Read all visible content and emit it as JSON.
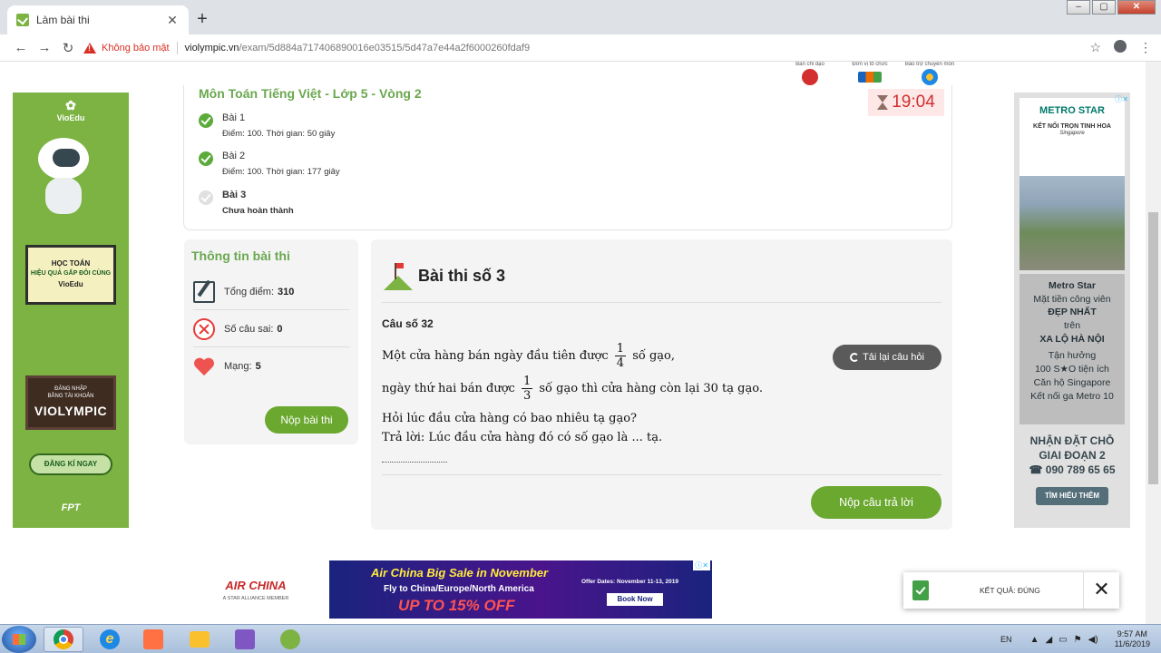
{
  "browser": {
    "tab_title": "Làm bài thi",
    "new_tab": "+",
    "tab_close": "✕",
    "security_label": "Không bảo mật",
    "url_domain": "violympic.vn",
    "url_path": "/exam/5d884a717406890016e03515/5d47a7e44a2f6000260fdaf9",
    "nav": {
      "back": "←",
      "forward": "→",
      "reload": "↻"
    },
    "bookmark": "☆",
    "menu": "⋮",
    "window_controls": [
      "–",
      "▢",
      "✕"
    ]
  },
  "orgs": [
    {
      "label": "Ban chỉ đạo",
      "icon": "emblem-icon"
    },
    {
      "label": "Đơn vị tổ chức",
      "icon": "fpt-logo-icon"
    },
    {
      "label": "Bảo trợ chuyên môn",
      "icon": "globe-icon"
    }
  ],
  "left_ad": {
    "brand": "VioEdu",
    "headline": "HỌC TOÁN",
    "tagline": "HIỆU QUẢ GẤP ĐÔI CÙNG",
    "tagline_brand": "VioEdu",
    "login_line1": "ĐĂNG NHẬP",
    "login_line2": "BẰNG TÀI KHOẢN",
    "login_brand": "VIOLYMPIC",
    "cta": "ĐĂNG KÍ NGAY",
    "footer": "FPT"
  },
  "right_ad": {
    "brand": "METRO STAR",
    "tagline": "KẾT NỐI TRỌN TINH HOA",
    "tagline_sub": "Singapore",
    "mid_lines": [
      "Metro Star",
      "Mặt tiền công viên",
      "ĐẸP NHẤT",
      "trên",
      "XA LỘ HÀ NỘI",
      "Tận hưởng",
      "100 S★O tiện ích",
      "Căn hộ Singapore",
      "Kết nối ga Metro 10"
    ],
    "bottom_line1": "NHẬN ĐẶT CHỖ",
    "bottom_line2": "GIAI ĐOẠN 2",
    "phone": "090 789 65 65",
    "button": "TÌM HIỂU THÊM"
  },
  "exam": {
    "course": "Môn Toán Tiếng Việt - Lớp 5 - Vòng 2",
    "timer": "19:04",
    "rounds": [
      {
        "name": "Bài 1",
        "meta": "Điểm: 100. Thời gian: 50 giây",
        "done": true
      },
      {
        "name": "Bài 2",
        "meta": "Điểm: 100. Thời gian: 177 giây",
        "done": true
      },
      {
        "name": "Bài 3",
        "meta": "Chưa hoàn thành",
        "done": false
      }
    ]
  },
  "info": {
    "title": "Thông tin bài thi",
    "total_label": "Tổng điểm:",
    "total_value": "310",
    "wrong_label": "Số câu sai:",
    "wrong_value": "0",
    "lives_label": "Mạng:",
    "lives_value": "5",
    "submit": "Nộp bài thi"
  },
  "question": {
    "title": "Bài thi số 3",
    "number": "Câu số 32",
    "line1_pre": "Một cửa hàng bán ngày đầu tiên được",
    "frac1_num": "1",
    "frac1_den": "4",
    "line1_post": "số gạo,",
    "line2_pre": "ngày thứ hai bán được",
    "frac2_num": "1",
    "frac2_den": "3",
    "line2_post": "số gạo thì cửa hàng còn lại 30 tạ gạo.",
    "line3": "Hỏi lúc đầu cửa hàng có bao nhiêu tạ gạo?",
    "line4": "Trả lời: Lúc đầu cửa hàng đó có số gạo là  ... tạ.",
    "answer_value": "",
    "reload": "Tải lại câu hỏi",
    "submit": "Nộp câu trả lời"
  },
  "bottom_ad": {
    "airline": "AIR CHINA",
    "alliance": "A STAR ALLIANCE MEMBER",
    "headline": "Air China Big Sale in November",
    "route": "Fly to China/Europe/North America",
    "discount": "UP TO 15% OFF",
    "offer_dates": "Offer Dates: November 11-13, 2019",
    "book": "Book Now"
  },
  "toast": {
    "message": "KẾT QUẢ: ĐÚNG",
    "close": "✕"
  },
  "taskbar": {
    "lang": "EN",
    "time": "9:57 AM",
    "date": "11/6/2019"
  }
}
